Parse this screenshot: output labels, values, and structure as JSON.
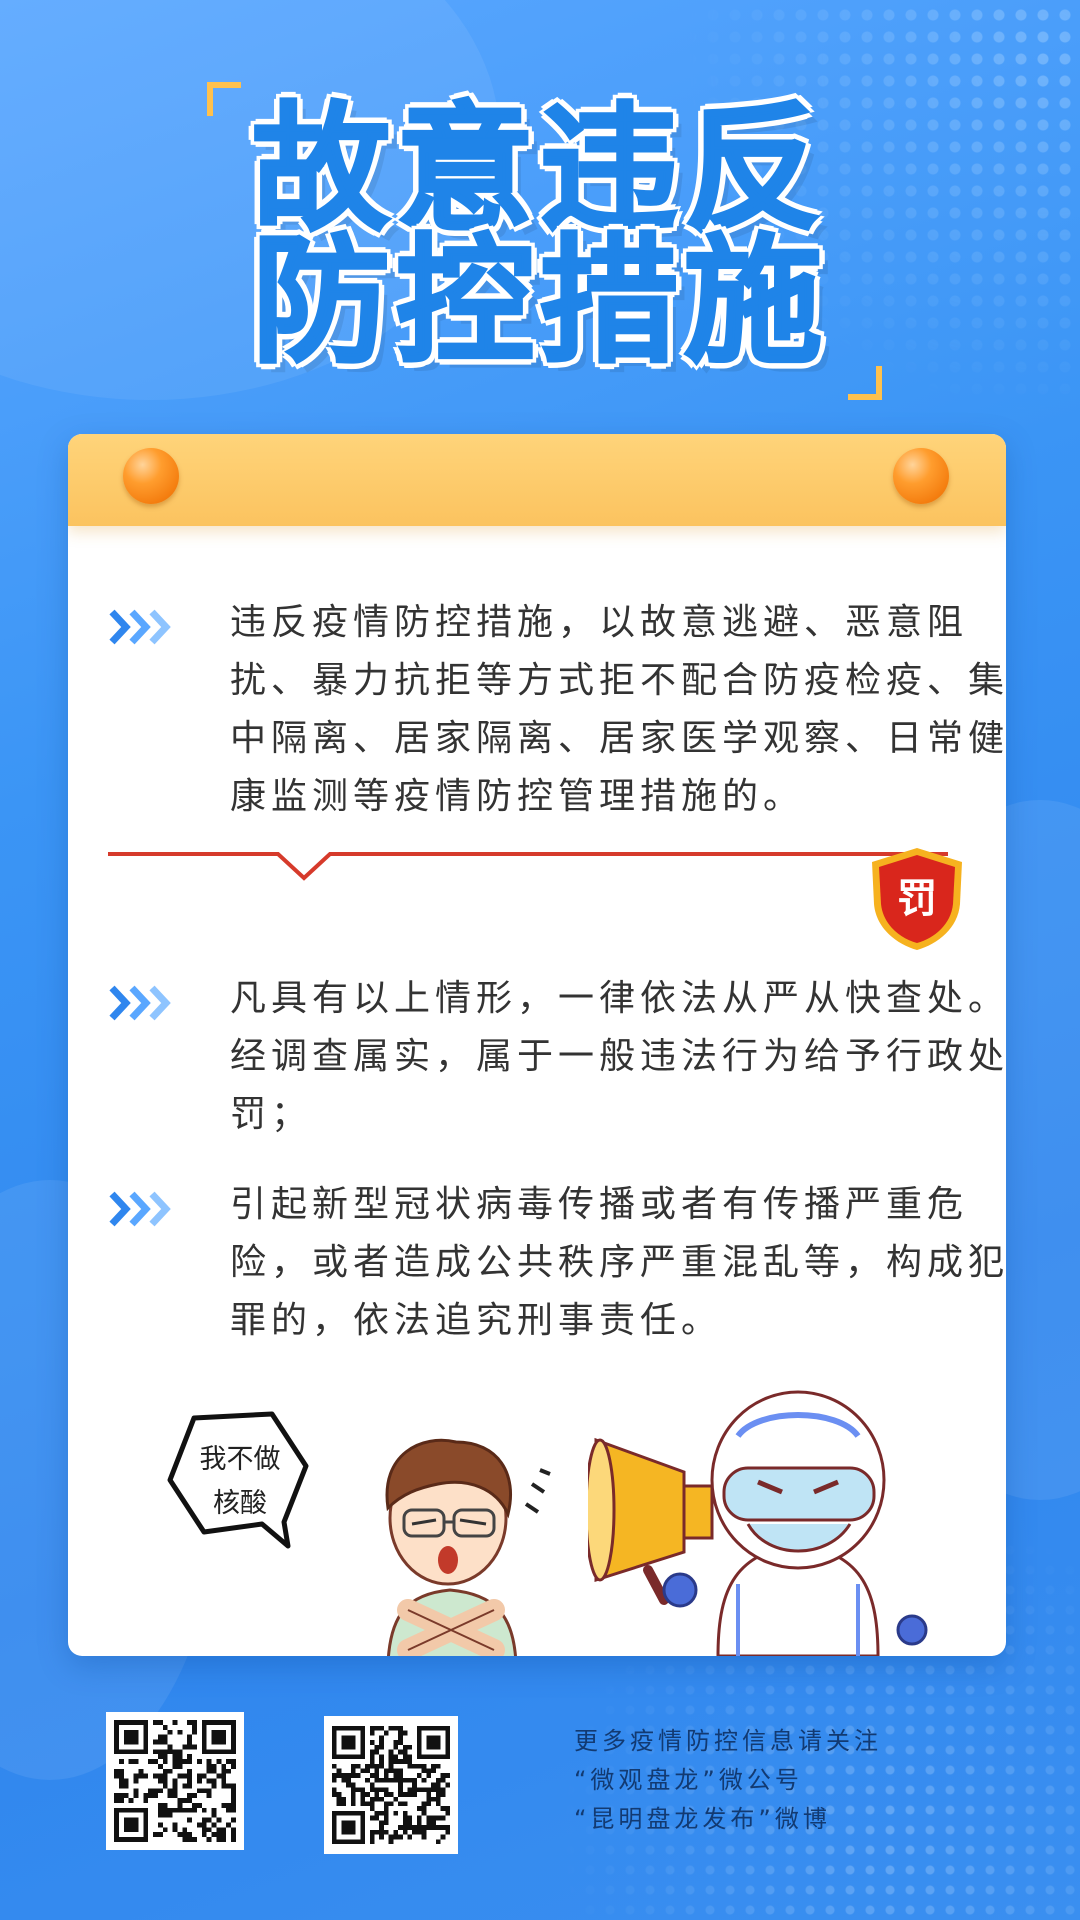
{
  "title": {
    "line1": "故意违反",
    "line2": "防控措施"
  },
  "items": [
    {
      "text": "违反疫情防控措施，以故意逃避、恶意阻扰、暴力抗拒等方式拒不配合防疫检疫、集中隔离、居家隔离、居家医学观察、日常健康监测等疫情防控管理措施的。"
    },
    {
      "text": "凡具有以上情形，一律依法从严从快查处。经调查属实，属于一般违法行为给予行政处罚；"
    },
    {
      "text": "引起新型冠状病毒传播或者有传播严重危险，或者造成公共秩序严重混乱等，构成犯罪的，依法追究刑事责任。"
    }
  ],
  "badge": {
    "text": "罚",
    "color": "#d9261c"
  },
  "speech_bubble": {
    "line1": "我不做",
    "line2": "核酸"
  },
  "footer": {
    "line1": "更多疫情防控信息请关注",
    "line2": "“微观盘龙”微公号",
    "line3": "“昆明盘龙发布”微博"
  },
  "colors": {
    "primary": "#1f84e8",
    "accent": "#fbc35f",
    "pin": "#f47d0f",
    "divider": "#d63a2b"
  }
}
